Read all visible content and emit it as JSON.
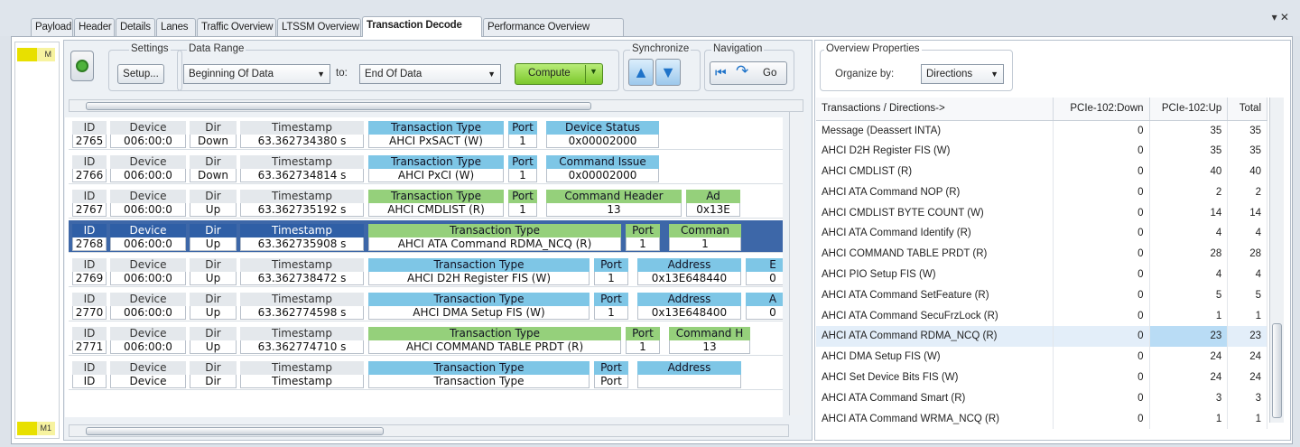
{
  "tabs": [
    "Payload",
    "Header",
    "Details",
    "Lanes",
    "Traffic Overview",
    "LTSSM Overview",
    "Transaction Decode",
    "Performance Overview"
  ],
  "active_tab": "Transaction Decode",
  "window_controls": "▾ ✕",
  "markers": {
    "top": "M",
    "bottom": "M1"
  },
  "toolbar": {
    "settings_label": "Settings",
    "setup_button": "Setup...",
    "data_range_label": "Data Range",
    "range_start": "Beginning Of Data",
    "to_label": "to:",
    "range_end": "End Of Data",
    "compute_button": "Compute",
    "synchronize_label": "Synchronize",
    "navigation_label": "Navigation",
    "go_button": "Go"
  },
  "transactions": [
    {
      "id": "2765",
      "device": "006:00:0",
      "dir": "Down",
      "timestamp": "63.362734380 s",
      "type": "AHCI PxSACT (W)",
      "port": "1",
      "extra_h": "Device Status",
      "extra_v": "0x00002000",
      "color": "blue"
    },
    {
      "id": "2766",
      "device": "006:00:0",
      "dir": "Down",
      "timestamp": "63.362734814 s",
      "type": "AHCI PxCI (W)",
      "port": "1",
      "extra_h": "Command Issue",
      "extra_v": "0x00002000",
      "color": "blue"
    },
    {
      "id": "2767",
      "device": "006:00:0",
      "dir": "Up",
      "timestamp": "63.362735192 s",
      "type": "AHCI CMDLIST (R)",
      "port": "1",
      "extra_h": "Command Header",
      "extra_v": "13",
      "more_h": "Ad",
      "more_v": "0x13E",
      "color": "green"
    },
    {
      "id": "2768",
      "device": "006:00:0",
      "dir": "Up",
      "timestamp": "63.362735908 s",
      "type": "AHCI ATA Command RDMA_NCQ (R)",
      "port": "1",
      "extra_h": "Comman",
      "extra_v": "1",
      "color": "green"
    },
    {
      "id": "2769",
      "device": "006:00:0",
      "dir": "Up",
      "timestamp": "63.362738472 s",
      "type": "AHCI D2H Register FIS (W)",
      "port": "1",
      "extra_h": "Address",
      "extra_v": "0x13E648440",
      "more_h": "E",
      "more_v": "0",
      "color": "blue"
    },
    {
      "id": "2770",
      "device": "006:00:0",
      "dir": "Up",
      "timestamp": "63.362774598 s",
      "type": "AHCI DMA Setup FIS (W)",
      "port": "1",
      "extra_h": "Address",
      "extra_v": "0x13E648400",
      "more_h": "A",
      "more_v": "0",
      "color": "blue"
    },
    {
      "id": "2771",
      "device": "006:00:0",
      "dir": "Up",
      "timestamp": "63.362774710 s",
      "type": "AHCI COMMAND TABLE PRDT (R)",
      "port": "1",
      "extra_h": "Command H",
      "extra_v": "13",
      "color": "green"
    },
    {
      "id": "ID",
      "device": "Device",
      "dir": "Dir",
      "timestamp": "Timestamp",
      "type": "Transaction Type",
      "port": "Port",
      "extra_h": "Address",
      "extra_v": "",
      "color": "blue"
    }
  ],
  "col_headers": {
    "id": "ID",
    "device": "Device",
    "dir": "Dir",
    "timestamp": "Timestamp",
    "type": "Transaction Type",
    "port": "Port"
  },
  "overview": {
    "properties_label": "Overview Properties",
    "organize_label": "Organize by:",
    "organize_value": "Directions",
    "columns": [
      "Transactions / Directions->",
      "PCIe-102:Down",
      "PCIe-102:Up",
      "Total"
    ],
    "rows": [
      [
        "Message (Deassert INTA)",
        "0",
        "35",
        "35"
      ],
      [
        "AHCI D2H Register FIS (W)",
        "0",
        "35",
        "35"
      ],
      [
        "AHCI CMDLIST (R)",
        "0",
        "40",
        "40"
      ],
      [
        "AHCI ATA Command NOP (R)",
        "0",
        "2",
        "2"
      ],
      [
        "AHCI CMDLIST BYTE COUNT (W)",
        "0",
        "14",
        "14"
      ],
      [
        "AHCI ATA Command Identify (R)",
        "0",
        "4",
        "4"
      ],
      [
        "AHCI COMMAND TABLE PRDT (R)",
        "0",
        "28",
        "28"
      ],
      [
        "AHCI PIO Setup FIS (W)",
        "0",
        "4",
        "4"
      ],
      [
        "AHCI ATA Command SetFeature (R)",
        "0",
        "5",
        "5"
      ],
      [
        "AHCI ATA Command SecuFrzLock (R)",
        "0",
        "1",
        "1"
      ],
      [
        "AHCI ATA Command RDMA_NCQ (R)",
        "0",
        "23",
        "23"
      ],
      [
        "AHCI DMA Setup FIS (W)",
        "0",
        "24",
        "24"
      ],
      [
        "AHCI Set Device Bits FIS (W)",
        "0",
        "24",
        "24"
      ],
      [
        "AHCI ATA Command Smart (R)",
        "0",
        "3",
        "3"
      ],
      [
        "AHCI ATA Command WRMA_NCQ (R)",
        "0",
        "1",
        "1"
      ]
    ],
    "highlighted_row": "AHCI ATA Command RDMA_NCQ (R)"
  },
  "colors": {
    "selected_row": "#3d67a8",
    "blue_header": "#7ec6e6",
    "green_header": "#95d07b",
    "compute": "#8fd43c"
  }
}
